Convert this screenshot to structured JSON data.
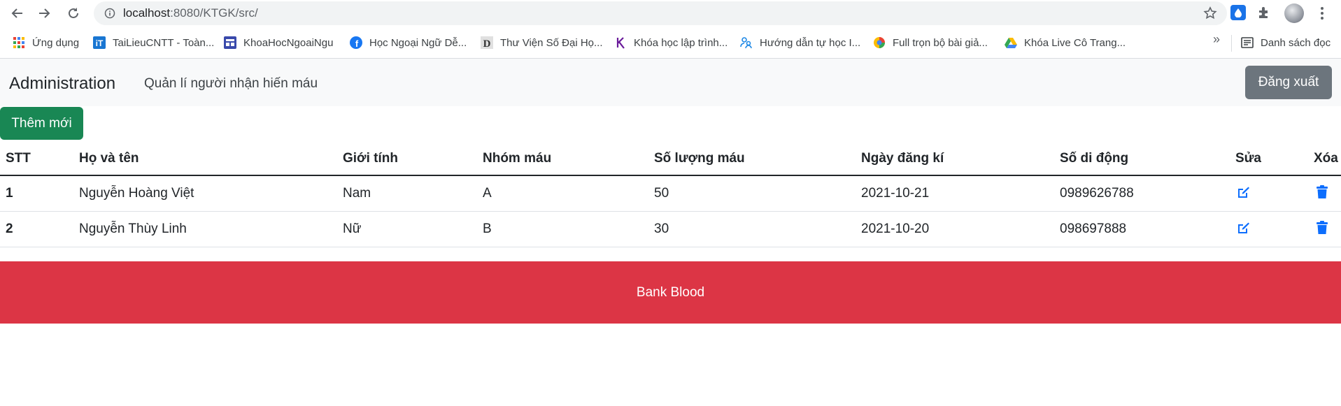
{
  "browser": {
    "url_host": "localhost",
    "url_path": ":8080/KTGK/src/"
  },
  "bookmarks": [
    {
      "label": "Ứng dụng",
      "icon": "apps-grid-icon"
    },
    {
      "label": "TaiLieuCNTT - Toàn...",
      "icon": "tailieu-icon"
    },
    {
      "label": "KhoaHocNgoaiNgu",
      "icon": "page-icon"
    },
    {
      "label": "Học Ngoại Ngữ Dễ...",
      "icon": "facebook-icon"
    },
    {
      "label": "Thư Viện Số Đại Họ...",
      "icon": "library-d-icon"
    },
    {
      "label": "Khóa học lập trình...",
      "icon": "k-logo-icon"
    },
    {
      "label": "Hướng dẫn tự học I...",
      "icon": "people-icon"
    },
    {
      "label": "Full trọn bộ bài giả...",
      "icon": "color-circle-icon"
    },
    {
      "label": "Khóa Live Cô Trang...",
      "icon": "google-drive-icon"
    }
  ],
  "reading_list": "Danh sách đọc",
  "app": {
    "brand": "Administration",
    "nav_link": "Quản lí người nhận hiến máu",
    "logout": "Đăng xuất",
    "add_new": "Thêm mới"
  },
  "table": {
    "headers": [
      "STT",
      "Họ và tên",
      "Giới tính",
      "Nhóm máu",
      "Số lượng máu",
      "Ngày đăng kí",
      "Số di động",
      "Sửa",
      "Xóa"
    ],
    "rows": [
      {
        "stt": "1",
        "name": "Nguyễn Hoàng Việt",
        "gender": "Nam",
        "blood": "A",
        "amount": "50",
        "date": "2021-10-21",
        "phone": "0989626788"
      },
      {
        "stt": "2",
        "name": "Nguyễn Thùy Linh",
        "gender": "Nữ",
        "blood": "B",
        "amount": "30",
        "date": "2021-10-20",
        "phone": "098697888"
      }
    ]
  },
  "footer": "Bank Blood",
  "colors": {
    "primary": "#0d6efd",
    "success": "#198754",
    "secondary": "#6c757d",
    "danger": "#dc3545"
  }
}
